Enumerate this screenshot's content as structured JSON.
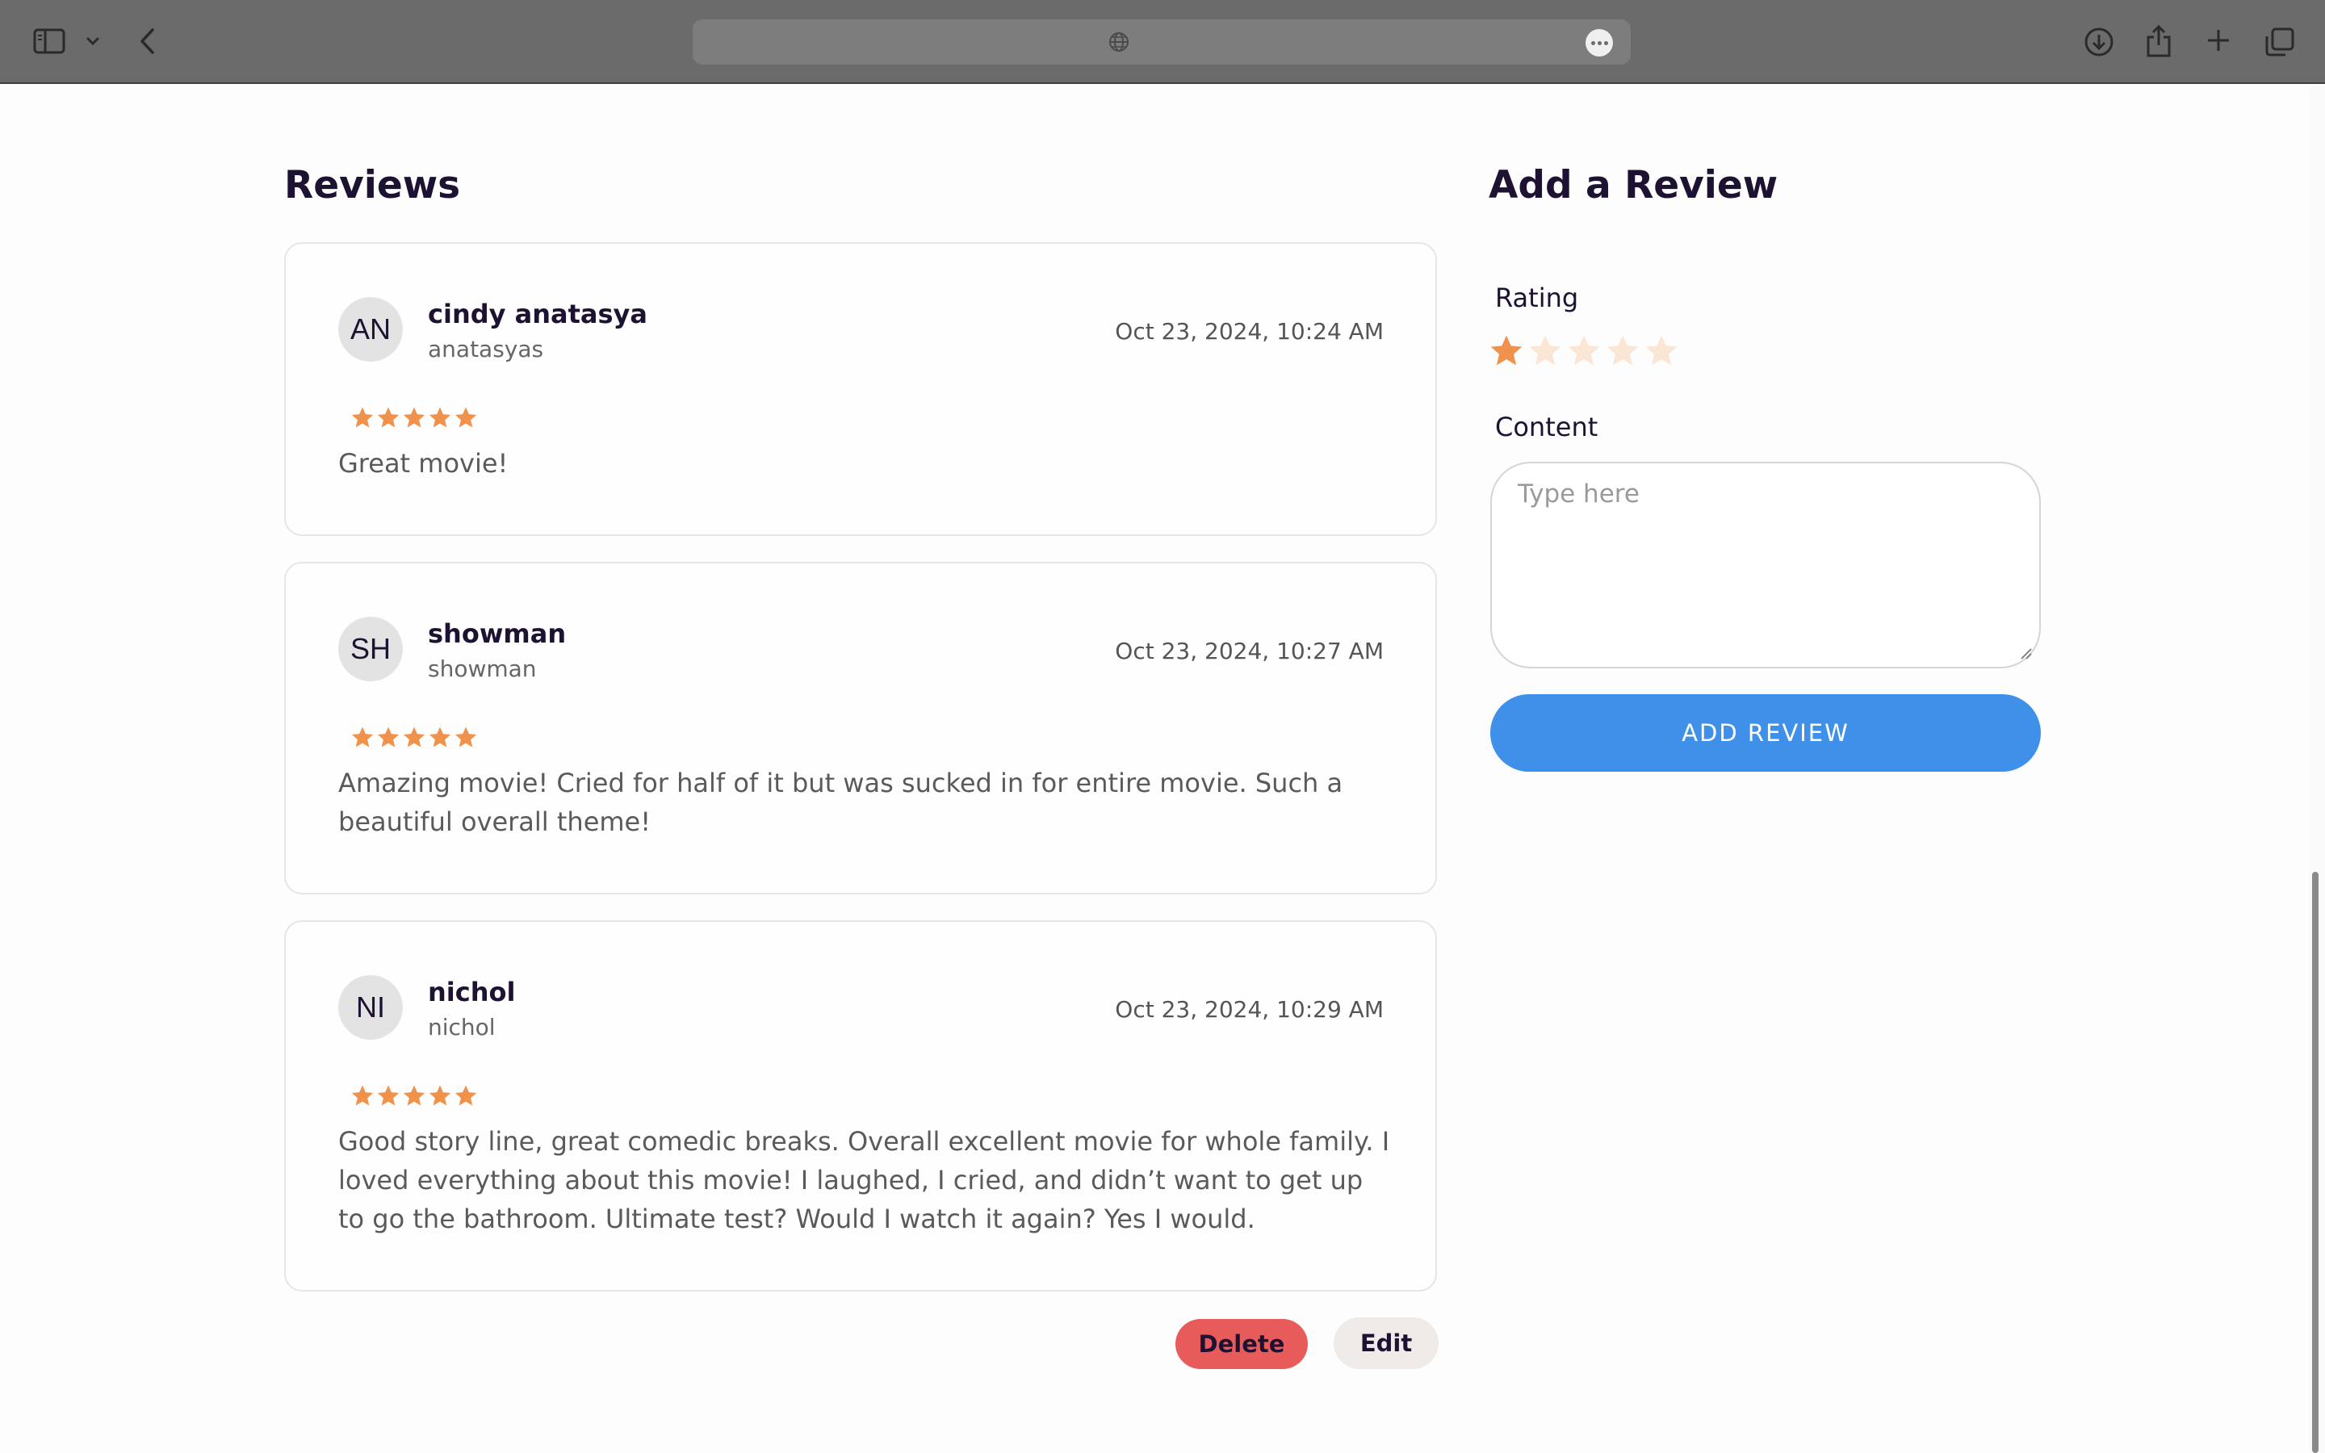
{
  "browser": {
    "toolbar_color": "#6b6b6b",
    "icons": [
      "sidebar-icon",
      "chevron-down-icon",
      "back-arrow-icon",
      "globe-icon",
      "more-icon",
      "download-icon",
      "share-icon",
      "new-tab-icon",
      "tabs-overview-icon"
    ]
  },
  "reviews": {
    "title": "Reviews",
    "star_color": "#f0924c",
    "items": [
      {
        "initials": "AN",
        "name": "cindy anatasya",
        "username": "anatasyas",
        "date": "Oct 23, 2024, 10:24 AM",
        "rating": 5,
        "content": "Great movie!"
      },
      {
        "initials": "SH",
        "name": "showman",
        "username": "showman",
        "date": "Oct 23, 2024, 10:27 AM",
        "rating": 5,
        "content": "Amazing movie! Cried for half of it but was sucked in for entire movie. Such a beautiful overall theme!"
      },
      {
        "initials": "NI",
        "name": "nichol",
        "username": "nichol",
        "date": "Oct 23, 2024, 10:29 AM",
        "rating": 5,
        "content": "Good story line, great comedic breaks. Overall excellent movie for whole family. I loved everything about this movie! I laughed, I cried, and didn’t want to get up to go the bathroom. Ultimate test? Would I watch it again? Yes I would."
      }
    ],
    "actions": {
      "delete_label": "Delete",
      "edit_label": "Edit",
      "delete_color": "#e85b5b"
    }
  },
  "add_review": {
    "title": "Add a Review",
    "rating_label": "Rating",
    "rating_value": 1,
    "rating_max": 5,
    "content_label": "Content",
    "content_placeholder": "Type here",
    "submit_label": "ADD REVIEW",
    "submit_color": "#3f90e8"
  }
}
